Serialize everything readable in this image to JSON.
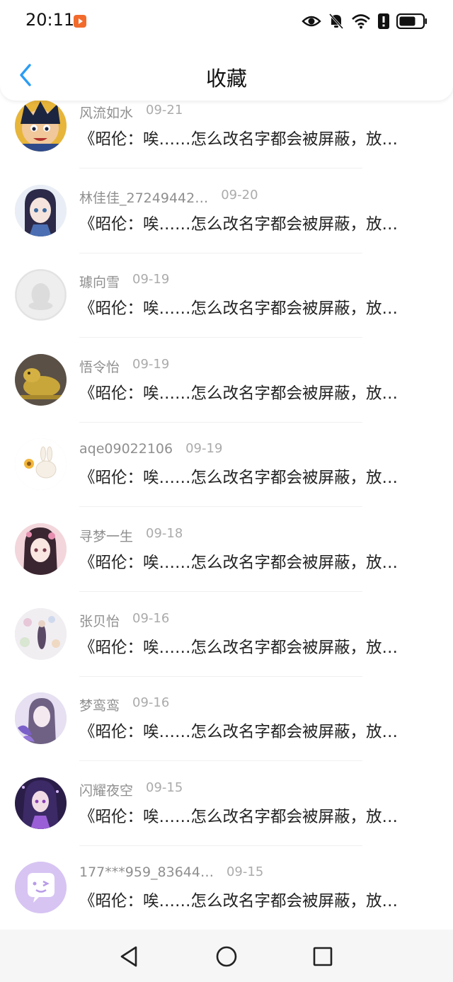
{
  "status_bar": {
    "time": "20:11",
    "icons": [
      "video-app-icon",
      "eye-icon",
      "bell-off-icon",
      "wifi-icon",
      "alert-icon",
      "battery-icon"
    ]
  },
  "header": {
    "title": "收藏",
    "back_icon": "chevron-left-icon",
    "back_color": "#2a9df4"
  },
  "favorites": [
    {
      "name": "风流如水",
      "date": "09-21",
      "content": "《昭伦：唉……怎么改名字都会被屏蔽，放…"
    },
    {
      "name": "林佳佳_27249442…",
      "date": "09-20",
      "content": "《昭伦：唉……怎么改名字都会被屏蔽，放…"
    },
    {
      "name": "璩向雪",
      "date": "09-19",
      "content": "《昭伦：唉……怎么改名字都会被屏蔽，放…"
    },
    {
      "name": "悟令怡",
      "date": "09-19",
      "content": "《昭伦：唉……怎么改名字都会被屏蔽，放…"
    },
    {
      "name": "aqe09022106",
      "date": "09-19",
      "content": "《昭伦：唉……怎么改名字都会被屏蔽，放…"
    },
    {
      "name": "寻梦一生",
      "date": "09-18",
      "content": "《昭伦：唉……怎么改名字都会被屏蔽，放…"
    },
    {
      "name": "张贝怡",
      "date": "09-16",
      "content": "《昭伦：唉……怎么改名字都会被屏蔽，放…"
    },
    {
      "name": "梦鸾鸾",
      "date": "09-16",
      "content": "《昭伦：唉……怎么改名字都会被屏蔽，放…"
    },
    {
      "name": "闪耀夜空",
      "date": "09-15",
      "content": "《昭伦：唉……怎么改名字都会被屏蔽，放…"
    },
    {
      "name": "177***959_83644…",
      "date": "09-15",
      "content": "《昭伦：唉……怎么改名字都会被屏蔽，放…"
    }
  ],
  "bottom_nav": {
    "icons": [
      "back-triangle-icon",
      "home-circle-icon",
      "recents-square-icon"
    ]
  },
  "colors": {
    "accent": "#2a9df4",
    "name_text": "#8f8f8f",
    "date_text": "#ababab",
    "content_text": "#222222"
  }
}
